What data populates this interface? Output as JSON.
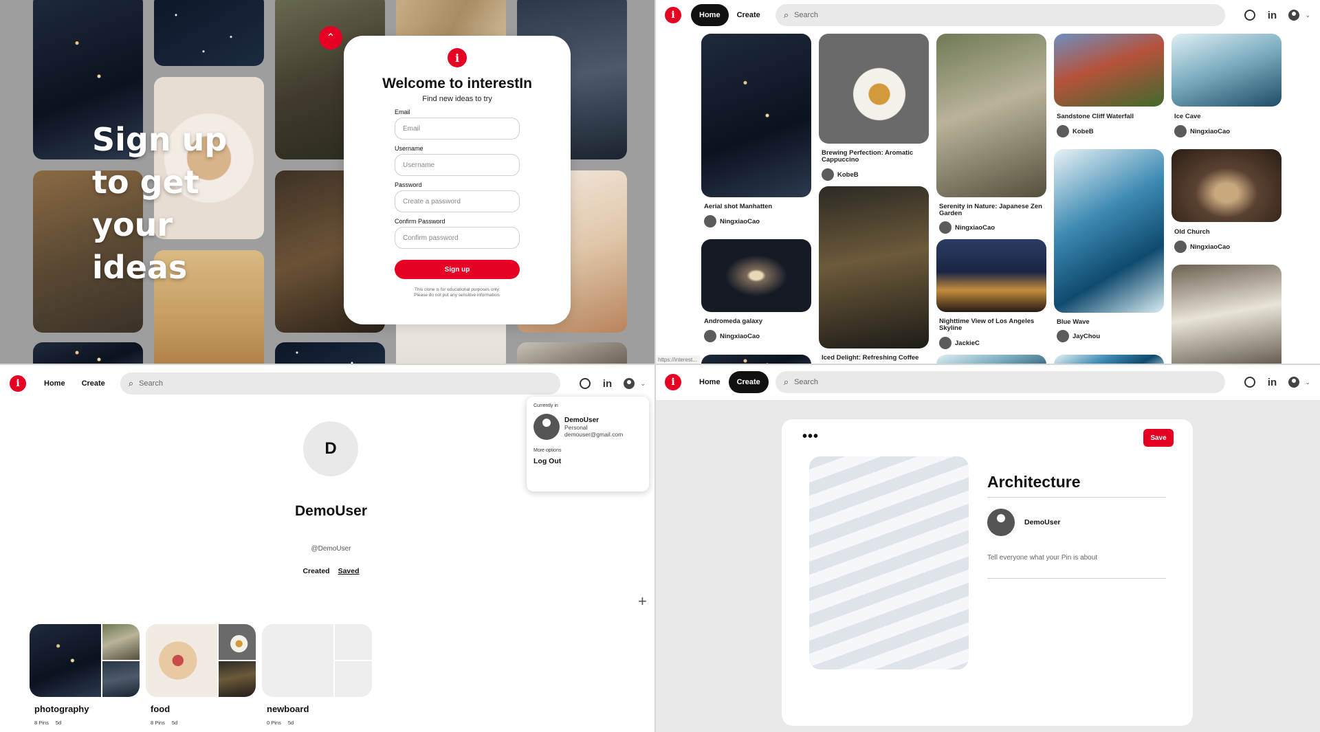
{
  "signup": {
    "hero_text": "Sign up to get your ideas",
    "logo_letter": "i",
    "title": "Welcome to interestIn",
    "subtitle": "Find new ideas to try",
    "fields": [
      {
        "label": "Email",
        "placeholder": "Email"
      },
      {
        "label": "Username",
        "placeholder": "Username"
      },
      {
        "label": "Password",
        "placeholder": "Create a password"
      },
      {
        "label": "Confirm Password",
        "placeholder": "Confirm password"
      }
    ],
    "button": "Sign up",
    "disclaimer_1": "This clone is for educational purposes only.",
    "disclaimer_2": "Please do not put any sensitive information.",
    "up_icon": "chevron-up-icon"
  },
  "header": {
    "logo_letter": "i",
    "home": "Home",
    "create": "Create",
    "search_placeholder": "Search",
    "icons": [
      "github-icon",
      "linkedin-icon",
      "account-icon",
      "chevron-down-icon"
    ],
    "linkedin_text": "in",
    "chevron": "⌄"
  },
  "feed": {
    "pins": [
      {
        "title": "Aerial shot Manhatten",
        "user": "NingxiaoCao"
      },
      {
        "title": "Andromeda galaxy",
        "user": "NingxiaoCao"
      },
      {
        "title": "Brewing Perfection: Aromatic Cappuccino",
        "user": "KobeB"
      },
      {
        "title": "Iced Delight: Refreshing Coffee",
        "user": ""
      },
      {
        "title": "Serenity in Nature: Japanese Zen Garden",
        "user": "NingxiaoCao"
      },
      {
        "title": "Nighttime View of Los Angeles Skyline",
        "user": "JackieC"
      },
      {
        "title": "Sandstone Cliff Waterfall",
        "user": "KobeB"
      },
      {
        "title": "Blue Wave",
        "user": "JayChou"
      },
      {
        "title": "Ice Cave",
        "user": "NingxiaoCao"
      },
      {
        "title": "Old Church",
        "user": "NingxiaoCao"
      }
    ],
    "status_url": "https://interest..."
  },
  "profile": {
    "initial": "D",
    "name": "DemoUser",
    "handle": "@DemoUser",
    "tab_created": "Created",
    "tab_saved": "Saved",
    "add_symbol": "+",
    "boards": [
      {
        "name": "photography",
        "pins": "8 Pins",
        "age": "5d"
      },
      {
        "name": "food",
        "pins": "8 Pins",
        "age": "5d"
      },
      {
        "name": "newboard",
        "pins": "0 Pins",
        "age": "5d"
      }
    ],
    "dropdown": {
      "currently_in": "Currently in",
      "user": "DemoUser",
      "type": "Personal",
      "email": "demouser@gmail.com",
      "more_options": "More options",
      "logout": "Log Out"
    }
  },
  "create_pin": {
    "menu": "•••",
    "save": "Save",
    "title": "Architecture",
    "user": "DemoUser",
    "description_placeholder": "Tell everyone what your Pin is about"
  },
  "colors": {
    "brand": "#e60023",
    "dark": "#111111",
    "search_bg": "#e9e9e9"
  }
}
